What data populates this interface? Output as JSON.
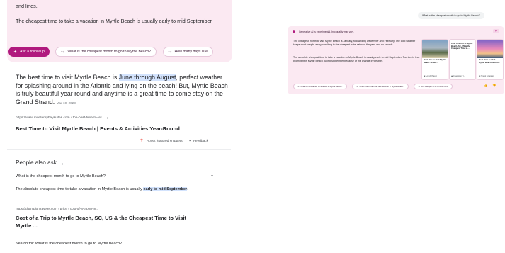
{
  "left": {
    "sge_prev_line": "and lines.",
    "sge_text": "The cheapest time to take a vacation in Myrtle Beach is usually early to mid September.",
    "chips": [
      {
        "label": "Ask a follow up"
      },
      {
        "label": "What is the cheapest month to go to Myrtle Beach?"
      },
      {
        "label": "How many days is e"
      }
    ],
    "snippet": {
      "before": "The best time to visit Myrtle Beach is ",
      "highlight": "June through August",
      "after": ", perfect weather for splashing around in the Atlantic and lying on the beach! But, Myrtle Beach is truly beautiful year round and anytime is a great time to come stay on the Grand Strand.",
      "date": "Mar 10, 2023"
    },
    "result1": {
      "url": "https://www.montereybaysuites.com › the-best-time-to-vis...",
      "title": "Best Time to Visit Myrtle Beach | Events & Activities Year-Round"
    },
    "about_snippets": "About featured snippets",
    "feedback": "Feedback",
    "paa": {
      "heading": "People also ask",
      "question": "What is the cheapest month to go to Myrtle Beach?",
      "answer_before": "The absolute cheapest time to take a vacation in Myrtle Beach is usually ",
      "answer_highlight": "early to mid September",
      "answer_after": ".",
      "url": "https://championtraveler.com › price › cost-of-a-trip-to-m...",
      "title": "Cost of a Trip to Myrtle Beach, SC, US & the Cheapest Time to Visit Myrtle ..."
    },
    "search_for": "Search for: What is the cheapest month to go to Myrtle Beach?"
  },
  "right": {
    "query": "What is the cheapest month to go to Myrtle Beach?",
    "header": "Generative AI is experimental. Info quality may vary.",
    "para1": "The cheapest month to visit Myrtle Beach is January, followed by December and February. The cold weather keeps most people away, resulting in the cheapest hotel rates of the year and no crowds.",
    "para2": "The absolute cheapest time to take a vacation in Myrtle Beach is usually early to mid September. Tourism is less prominent in Myrtle Beach during September because of the change in weather.",
    "cards": [
      {
        "title": "Best time to visit Myrtle Beach - Lowd...",
        "source": "Lonely Planet"
      },
      {
        "title": "Cost of a Trip to Myrtle Beach, SC, US & the Cheapest Time to...",
        "source": "Champion Tr..."
      },
      {
        "title": "Best Time to Visit Myrtle Beach: Month...",
        "source": "Travel & Leisure"
      }
    ],
    "followups": [
      "What is considered off-season in Myrtle Beach?",
      "What month has the best weather in Myrtle Beach?",
      "Is it cheaper to fly or drive to M"
    ],
    "colors": {
      "accent": "#b0197e",
      "card_bg": "#fbe9f2",
      "highlight": "#d3e3fd"
    }
  }
}
